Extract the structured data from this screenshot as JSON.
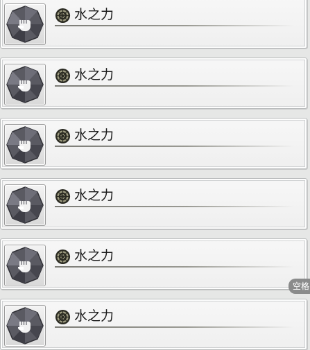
{
  "items": [
    {
      "title": "水之力",
      "icon": "fist-icon",
      "element_icon": "rune-icon"
    },
    {
      "title": "水之力",
      "icon": "fist-icon",
      "element_icon": "rune-icon"
    },
    {
      "title": "水之力",
      "icon": "fist-icon",
      "element_icon": "rune-icon"
    },
    {
      "title": "水之力",
      "icon": "fist-icon",
      "element_icon": "rune-icon"
    },
    {
      "title": "水之力",
      "icon": "fist-icon",
      "element_icon": "rune-icon"
    },
    {
      "title": "水之力",
      "icon": "fist-icon",
      "element_icon": "rune-icon"
    }
  ],
  "hint": {
    "label": "空格"
  }
}
